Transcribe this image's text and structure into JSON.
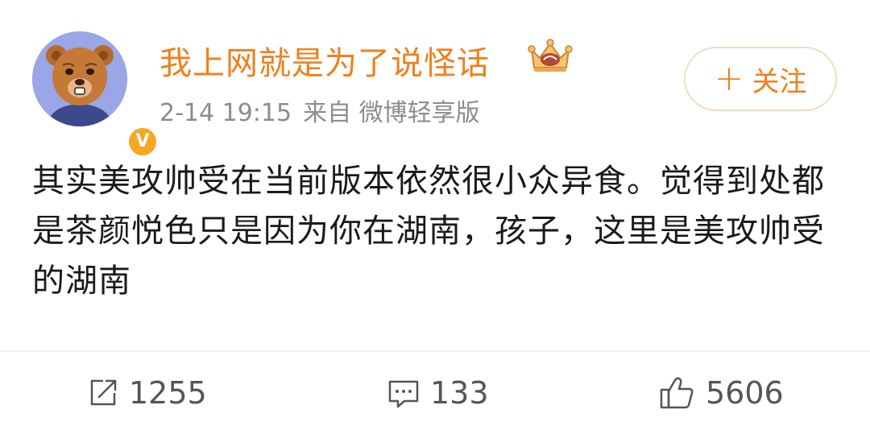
{
  "post": {
    "username": "我上网就是为了说怪话",
    "time": "2-14 19:15",
    "source": "来自 微博轻享版",
    "follow_label": "关注",
    "text": "其实美攻帅受在当前版本依然很小众异食。觉得到处都是茶颜悦色只是因为你在湖南，孩子，这里是美攻帅受的湖南"
  },
  "actions": {
    "reposts": "1255",
    "comments": "133",
    "likes": "5606"
  },
  "colors": {
    "accent": "#f07f1d",
    "avatar_bg": "#9aa6e6",
    "verified": "#f5a623"
  },
  "icons": {
    "avatar": "bear-avatar",
    "verified": "verified-v-icon",
    "crown": "crown-icon",
    "repost": "repost-icon",
    "comment": "comment-icon",
    "like": "thumbs-up-icon"
  }
}
